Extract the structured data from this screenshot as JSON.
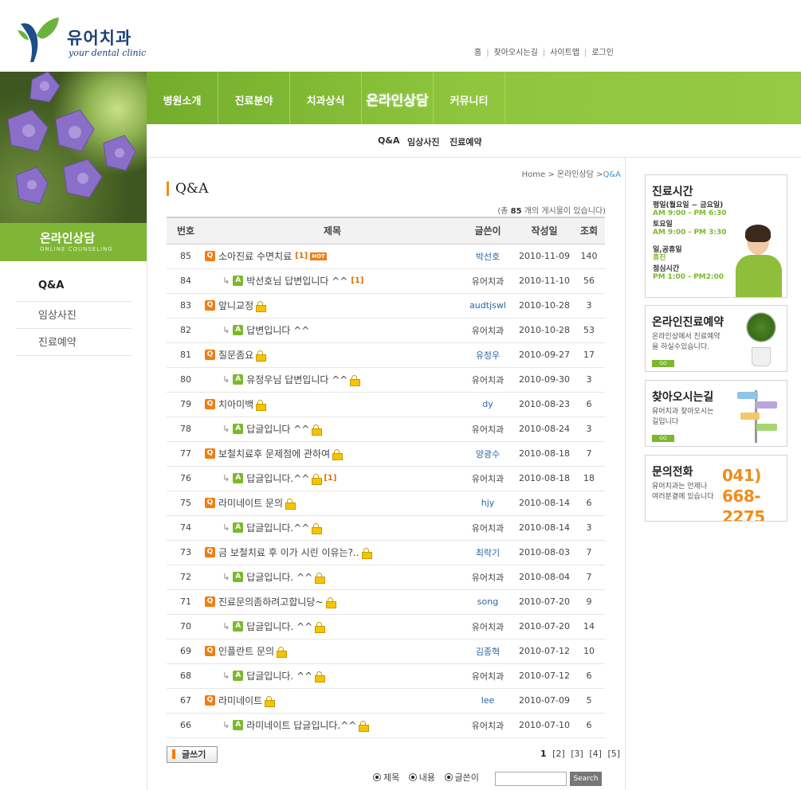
{
  "logo": {
    "name_kr": "유어치과",
    "name_en": "your dental clinic"
  },
  "topnav": [
    "홈",
    "찾아오시는길",
    "사이트맵",
    "로그인"
  ],
  "left": {
    "banner_title": "온라인상담",
    "banner_subtitle": "ONLINE COUNSELING",
    "menu": [
      "Q&A",
      "임상사진",
      "진료예약"
    ]
  },
  "mainnav": [
    "병원소개",
    "진료분야",
    "치과상식",
    "온라인상담",
    "커뮤니티"
  ],
  "subnav": [
    "Q&A",
    "임상사진",
    "진료예약"
  ],
  "breadcrumb": {
    "home": "Home",
    "sep": ">",
    "section": "온라인상담",
    "current": "Q&A"
  },
  "page_title": "Q&A",
  "count": {
    "prefix": "(총",
    "value": "85",
    "suffix": "개의 게시물이 있습니다)"
  },
  "columns": [
    "번호",
    "제목",
    "글쓴이",
    "작성일",
    "조회"
  ],
  "rows": [
    {
      "num": "85",
      "title": "소아진료 수면치료",
      "reply": false,
      "lock": false,
      "comments": "[1]",
      "hot": "HOT",
      "author": "박선호",
      "admin": false,
      "date": "2010-11-09",
      "views": "140"
    },
    {
      "num": "84",
      "title": "박선호님 답변입니다 ^^",
      "reply": true,
      "lock": false,
      "comments": "[1]",
      "hot": "",
      "author": "유어치과",
      "admin": true,
      "date": "2010-11-10",
      "views": "56"
    },
    {
      "num": "83",
      "title": "앞니교정",
      "reply": false,
      "lock": true,
      "comments": "",
      "hot": "",
      "author": "audtjswl",
      "admin": false,
      "date": "2010-10-28",
      "views": "3"
    },
    {
      "num": "82",
      "title": "답변입니다 ^^",
      "reply": true,
      "lock": false,
      "comments": "",
      "hot": "",
      "author": "유어치과",
      "admin": true,
      "date": "2010-10-28",
      "views": "53"
    },
    {
      "num": "81",
      "title": "질문좀요",
      "reply": false,
      "lock": true,
      "comments": "",
      "hot": "",
      "author": "유정우",
      "admin": false,
      "date": "2010-09-27",
      "views": "17"
    },
    {
      "num": "80",
      "title": "유정우님 답변입니다 ^^",
      "reply": true,
      "lock": true,
      "comments": "",
      "hot": "",
      "author": "유어치과",
      "admin": true,
      "date": "2010-09-30",
      "views": "3"
    },
    {
      "num": "79",
      "title": "치아미백",
      "reply": false,
      "lock": true,
      "comments": "",
      "hot": "",
      "author": "dy",
      "admin": false,
      "date": "2010-08-23",
      "views": "6"
    },
    {
      "num": "78",
      "title": "답글입니다 ^^",
      "reply": true,
      "lock": true,
      "comments": "",
      "hot": "",
      "author": "유어치과",
      "admin": true,
      "date": "2010-08-24",
      "views": "3"
    },
    {
      "num": "77",
      "title": "보철치료후 문제점에 관하여",
      "reply": false,
      "lock": true,
      "comments": "",
      "hot": "",
      "author": "양광수",
      "admin": false,
      "date": "2010-08-18",
      "views": "7"
    },
    {
      "num": "76",
      "title": "답글입니다.^^",
      "reply": true,
      "lock": true,
      "comments": "[1]",
      "hot": "",
      "author": "유어치과",
      "admin": true,
      "date": "2010-08-18",
      "views": "18"
    },
    {
      "num": "75",
      "title": "라미네이트 문의",
      "reply": false,
      "lock": true,
      "comments": "",
      "hot": "",
      "author": "hjy",
      "admin": false,
      "date": "2010-08-14",
      "views": "6"
    },
    {
      "num": "74",
      "title": "답글입니다.^^",
      "reply": true,
      "lock": true,
      "comments": "",
      "hot": "",
      "author": "유어치과",
      "admin": true,
      "date": "2010-08-14",
      "views": "3"
    },
    {
      "num": "73",
      "title": "금 보철치료 후 이가 시린 이유는?..",
      "reply": false,
      "lock": true,
      "comments": "",
      "hot": "",
      "author": "최락기",
      "admin": false,
      "date": "2010-08-03",
      "views": "7"
    },
    {
      "num": "72",
      "title": "답글입니다. ^^",
      "reply": true,
      "lock": true,
      "comments": "",
      "hot": "",
      "author": "유어치과",
      "admin": true,
      "date": "2010-08-04",
      "views": "7"
    },
    {
      "num": "71",
      "title": "진료문의좀하려고합니당~",
      "reply": false,
      "lock": true,
      "comments": "",
      "hot": "",
      "author": "song",
      "admin": false,
      "date": "2010-07-20",
      "views": "9"
    },
    {
      "num": "70",
      "title": "답글입니다. ^^",
      "reply": true,
      "lock": true,
      "comments": "",
      "hot": "",
      "author": "유어치과",
      "admin": true,
      "date": "2010-07-20",
      "views": "14"
    },
    {
      "num": "69",
      "title": "인플란트 문의",
      "reply": false,
      "lock": true,
      "comments": "",
      "hot": "",
      "author": "김종혁",
      "admin": false,
      "date": "2010-07-12",
      "views": "10"
    },
    {
      "num": "68",
      "title": "답글입니다. ^^",
      "reply": true,
      "lock": true,
      "comments": "",
      "hot": "",
      "author": "유어치과",
      "admin": true,
      "date": "2010-07-12",
      "views": "6"
    },
    {
      "num": "67",
      "title": "라미네이트",
      "reply": false,
      "lock": true,
      "comments": "",
      "hot": "",
      "author": "lee",
      "admin": false,
      "date": "2010-07-09",
      "views": "5"
    },
    {
      "num": "66",
      "title": "라미네이트 답글입니다.^^",
      "reply": true,
      "lock": true,
      "comments": "",
      "hot": "",
      "author": "유어치과",
      "admin": true,
      "date": "2010-07-10",
      "views": "6"
    }
  ],
  "write_label": "글쓰기",
  "pages": [
    "1",
    "[2]",
    "[3]",
    "[4]",
    "[5]"
  ],
  "search": {
    "options": [
      "제목",
      "내용",
      "글쓴이"
    ],
    "input_value": "",
    "button": "Search"
  },
  "side": {
    "hours": {
      "title": "진료시간",
      "lines": [
        {
          "label": "평일(월요일 ~ 금요일)",
          "time": "AM 9:00 - PM 6:30"
        },
        {
          "label": "토요일",
          "time": "AM 9:00 - PM 3:30"
        },
        {
          "label": "일,공휴일",
          "time": "휴진"
        },
        {
          "label": "점심시간",
          "time": "PM 1:00 - PM2:00"
        }
      ]
    },
    "booking": {
      "title": "온라인진료예약",
      "desc1": "온라인상에서 진료예약",
      "desc2": "을 하실수있습니다.",
      "go": "GO"
    },
    "direction": {
      "title": "찾아오시는길",
      "desc1": "유어치과 찾아오시는",
      "desc2": "길입니다",
      "go": "GO"
    },
    "phone": {
      "title": "문의전화",
      "desc1": "유어치과는 언제나",
      "desc2": "여러분곁에 있습니다",
      "number1": "041)",
      "number2": "668-2275"
    }
  },
  "colors": {
    "green": "#7fb635",
    "orange": "#ef7d14",
    "link": "#2a65a3"
  }
}
